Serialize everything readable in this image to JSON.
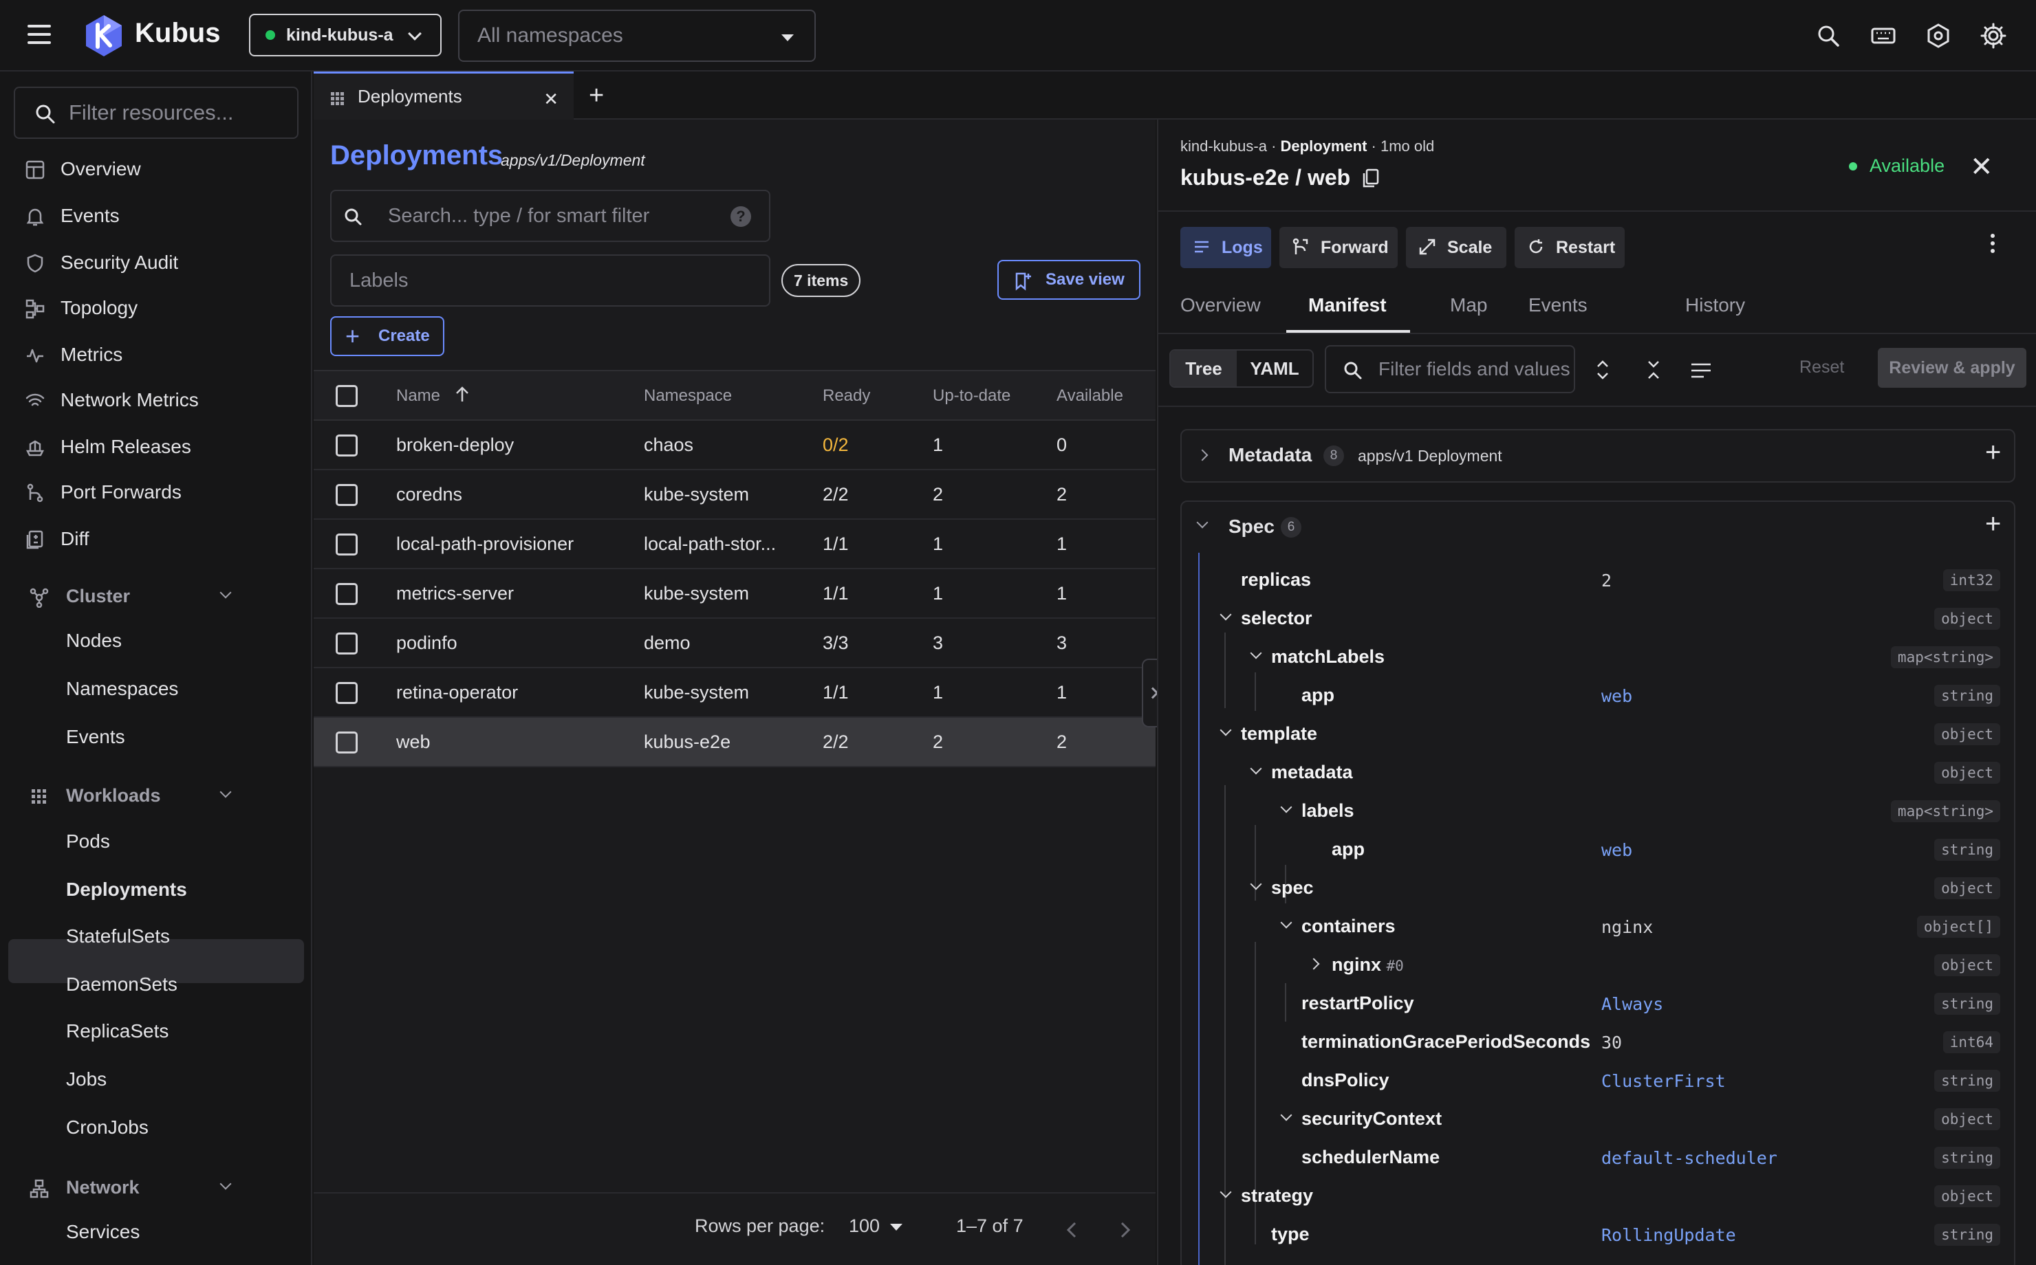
{
  "app": {
    "brand": "Kubus",
    "context": "kind-kubus-a",
    "namespace_placeholder": "All namespaces",
    "colors": {
      "accent": "#6b8cff",
      "ok": "#22c55e",
      "warn": "#f5b83d"
    }
  },
  "top_icons": [
    "search-icon",
    "keyboard-icon",
    "bug-settings-icon",
    "gear-icon"
  ],
  "sidebar": {
    "filter_placeholder": "Filter resources...",
    "items": [
      "Overview",
      "Events",
      "Security Audit",
      "Topology",
      "Metrics",
      "Network Metrics",
      "Helm Releases",
      "Port Forwards",
      "Diff"
    ],
    "cluster": {
      "title": "Cluster",
      "items": [
        "Nodes",
        "Namespaces",
        "Events"
      ]
    },
    "workloads": {
      "title": "Workloads",
      "items": [
        "Pods",
        "Deployments",
        "StatefulSets",
        "DaemonSets",
        "ReplicaSets",
        "Jobs",
        "CronJobs"
      ]
    },
    "network": {
      "title": "Network",
      "items": [
        "Services"
      ]
    }
  },
  "tabs": [
    {
      "label": "Deployments"
    }
  ],
  "list": {
    "title": "Deployments",
    "subtitle": "apps/v1/Deployment",
    "search_placeholder": "Search... type / for smart filter",
    "help": "?",
    "labels_placeholder": "Labels",
    "items_count": "7 items",
    "save_view": "Save view",
    "create": "Create",
    "columns": [
      "Name",
      "Namespace",
      "Ready",
      "Up-to-date",
      "Available"
    ],
    "rows": [
      {
        "name": "broken-deploy",
        "ns": "chaos",
        "ready": "0/2",
        "uptodate": "1",
        "available": "0"
      },
      {
        "name": "coredns",
        "ns": "kube-system",
        "ready": "2/2",
        "uptodate": "2",
        "available": "2"
      },
      {
        "name": "local-path-provisioner",
        "ns": "local-path-stor...",
        "ready": "1/1",
        "uptodate": "1",
        "available": "1"
      },
      {
        "name": "metrics-server",
        "ns": "kube-system",
        "ready": "1/1",
        "uptodate": "1",
        "available": "1"
      },
      {
        "name": "podinfo",
        "ns": "demo",
        "ready": "3/3",
        "uptodate": "3",
        "available": "3"
      },
      {
        "name": "retina-operator",
        "ns": "kube-system",
        "ready": "1/1",
        "uptodate": "1",
        "available": "1"
      },
      {
        "name": "web",
        "ns": "kubus-e2e",
        "ready": "2/2",
        "uptodate": "2",
        "available": "2"
      }
    ],
    "pager": {
      "rows_label": "Rows per page:",
      "rows_value": "100",
      "range": "1–7 of 7"
    }
  },
  "detail": {
    "crumb_ctx": "kind-kubus-a",
    "crumb_kind": "Deployment",
    "crumb_age": "1mo old",
    "title": "kubus-e2e / web",
    "status": "Available",
    "actions": [
      "Logs",
      "Forward",
      "Scale",
      "Restart"
    ],
    "tabs": [
      "Overview",
      "Manifest",
      "Map",
      "Events",
      "History"
    ],
    "view_tree": "Tree",
    "view_yaml": "YAML",
    "filter_placeholder": "Filter fields and values",
    "reset": "Reset",
    "review": "Review & apply",
    "metadata": {
      "title": "Metadata",
      "count": "8",
      "meta": "apps/v1 Deployment"
    },
    "spec": {
      "title": "Spec",
      "count": "6"
    },
    "tree": [
      {
        "key": "replicas",
        "val": "2",
        "type": "int32"
      },
      {
        "key": "selector",
        "val": "",
        "type": "object"
      },
      {
        "key": "matchLabels",
        "val": "",
        "type": "map<string>"
      },
      {
        "key": "app",
        "val": "web",
        "type": "string"
      },
      {
        "key": "template",
        "val": "",
        "type": "object"
      },
      {
        "key": "metadata",
        "val": "",
        "type": "object"
      },
      {
        "key": "labels",
        "val": "",
        "type": "map<string>"
      },
      {
        "key": "app",
        "val": "web",
        "type": "string"
      },
      {
        "key": "spec",
        "val": "",
        "type": "object"
      },
      {
        "key": "containers",
        "val": "nginx",
        "type": "object[]"
      },
      {
        "key": "nginx",
        "suffix": "#0",
        "val": "",
        "type": "object"
      },
      {
        "key": "restartPolicy",
        "val": "Always",
        "type": "string"
      },
      {
        "key": "terminationGracePeriodSeconds",
        "val": "30",
        "type": "int64"
      },
      {
        "key": "dnsPolicy",
        "val": "ClusterFirst",
        "type": "string"
      },
      {
        "key": "securityContext",
        "val": "",
        "type": "object"
      },
      {
        "key": "schedulerName",
        "val": "default-scheduler",
        "type": "string"
      },
      {
        "key": "strategy",
        "val": "",
        "type": "object"
      },
      {
        "key": "type",
        "val": "RollingUpdate",
        "type": "string"
      }
    ]
  }
}
